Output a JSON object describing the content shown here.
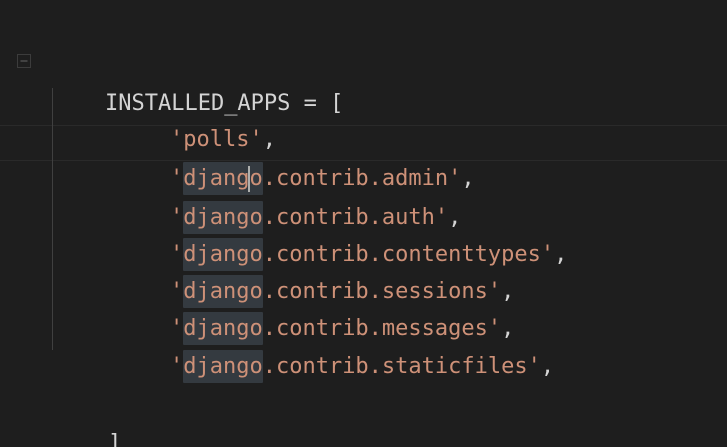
{
  "editor": {
    "language": "python",
    "colors": {
      "background": "#1e1e1e",
      "string": "#ce9178",
      "text": "#d4d4d4",
      "selection_highlight": "#343a40",
      "indent_guide": "#404040"
    },
    "fold_icon": "fold-collapse-icon",
    "code": {
      "line1": {
        "identifier": "INSTALLED_APPS",
        "operator": " = ",
        "bracket": "["
      },
      "apps": [
        {
          "quote_open": "'",
          "prefix": "",
          "rest": "polls",
          "quote_close": "'",
          "comma": ","
        },
        {
          "quote_open": "'",
          "prefix": "djang",
          "suffix": "o",
          "rest": ".contrib.admin",
          "quote_close": "'",
          "comma": ","
        },
        {
          "quote_open": "'",
          "prefix": "django",
          "rest": ".contrib.auth",
          "quote_close": "'",
          "comma": ","
        },
        {
          "quote_open": "'",
          "prefix": "django",
          "rest": ".contrib.contenttypes",
          "quote_close": "'",
          "comma": ","
        },
        {
          "quote_open": "'",
          "prefix": "django",
          "rest": ".contrib.sessions",
          "quote_close": "'",
          "comma": ","
        },
        {
          "quote_open": "'",
          "prefix": "django",
          "rest": ".contrib.messages",
          "quote_close": "'",
          "comma": ","
        },
        {
          "quote_open": "'",
          "prefix": "django",
          "rest": ".contrib.staticfiles",
          "quote_close": "'",
          "comma": ","
        }
      ],
      "closing_bracket": "]"
    }
  }
}
